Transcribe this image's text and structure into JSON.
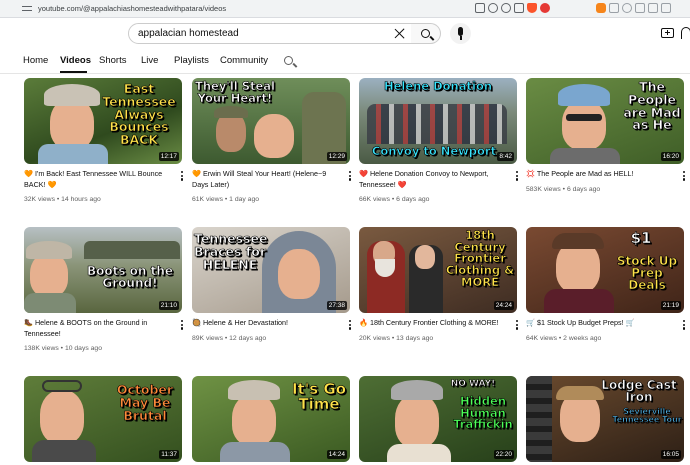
{
  "browser": {
    "url": "youtube.com/@appalachiashomesteadwithpatara/videos"
  },
  "header": {
    "search_value": "appalacian homestead"
  },
  "tabs": [
    {
      "label": "Home"
    },
    {
      "label": "Videos"
    },
    {
      "label": "Shorts"
    },
    {
      "label": "Live"
    },
    {
      "label": "Playlists"
    },
    {
      "label": "Community"
    }
  ],
  "videos": [
    {
      "title": "🧡 I'm Back! East Tennessee WILL Bounce BACK! 🧡",
      "views": "32K views",
      "age": "14 hours ago",
      "duration": "12:17",
      "thumb_text": "East Tennessee Always Bounces BACK"
    },
    {
      "title": "🧡 Erwin Will Steal Your Heart! (Helene~9 Days Later)",
      "views": "61K views",
      "age": "1 day ago",
      "duration": "12:29",
      "thumb_text": "They'll Steal Your Heart!"
    },
    {
      "title": "❤️ Helene Donation Convoy to Newport, Tennessee! ❤️",
      "views": "66K views",
      "age": "6 days ago",
      "duration": "8:42",
      "thumb_text_top": "Helene Donation",
      "thumb_text_bottom": "Convoy to Newport"
    },
    {
      "title": "💢 The People are Mad as HELL!",
      "views": "583K views",
      "age": "6 days ago",
      "duration": "16:20",
      "thumb_text": "The People are Mad as He"
    },
    {
      "title": "🥾 Helene & BOOTS on the Ground in Tennessee!",
      "views": "138K views",
      "age": "10 days ago",
      "duration": "21:10",
      "thumb_text": "Boots on the Ground!"
    },
    {
      "title": "🥘 Helene & Her Devastation!",
      "views": "89K views",
      "age": "12 days ago",
      "duration": "27:38",
      "thumb_text": "Tennessee Braces for HELENE"
    },
    {
      "title": "🔥 18th Century Frontier Clothing & MORE!",
      "views": "20K views",
      "age": "13 days ago",
      "duration": "24:24",
      "thumb_text": "18th Century Frontier Clothing & MORE"
    },
    {
      "title": "🛒 $1 Stock Up Budget Preps! 🛒",
      "views": "64K views",
      "age": "2 weeks ago",
      "duration": "21:19",
      "thumb_text_top": "$1",
      "thumb_text": "Stock Up Prep Deals"
    },
    {
      "duration": "11:37",
      "thumb_text": "October May Be Brutal"
    },
    {
      "duration": "14:24",
      "thumb_text": "It's Go Time"
    },
    {
      "duration": "22:20",
      "thumb_text_top": "NO WAY!",
      "thumb_text": "Hidden Human Traffickin"
    },
    {
      "duration": "16:05",
      "thumb_text": "Lodge Cast Iron",
      "thumb_text_sub": "Sevierville Tennessee Tour"
    }
  ]
}
